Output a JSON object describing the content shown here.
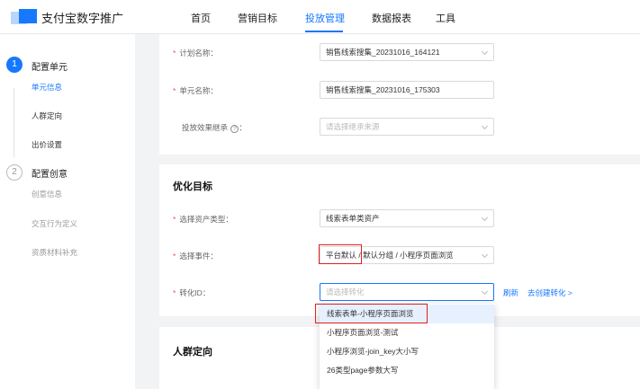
{
  "app": {
    "brand": "支付宝数字推广"
  },
  "nav": {
    "items": [
      "首页",
      "营销目标",
      "投放管理",
      "数据报表",
      "工具"
    ],
    "active_index": 2
  },
  "sidebar": {
    "steps": [
      {
        "num": "1",
        "title": "配置单元",
        "subs": [
          "单元信息",
          "人群定向",
          "出价设置"
        ]
      },
      {
        "num": "2",
        "title": "配置创意",
        "subs": [
          "创意信息",
          "交互行为定义",
          "资质材料补充"
        ]
      }
    ]
  },
  "form": {
    "plan_name": {
      "label": "计划名称：",
      "value": "销售线索搜集_20231016_164121"
    },
    "unit_name": {
      "label": "单元名称：",
      "value": "销售线索搜集_20231016_175303"
    },
    "effect_relay": {
      "label": "投放效果继承",
      "help": "?",
      "colon": "：",
      "placeholder": "请选择继承来源"
    }
  },
  "optimize": {
    "title": "优化目标",
    "asset_type": {
      "label": "选择资产类型：",
      "value": "线索表单类资产"
    },
    "event": {
      "label": "选择事件：",
      "value_highlight": "平台默认",
      "value_rest": " / 默认分组 / 小程序页面浏览"
    },
    "conversion": {
      "label": "转化ID：",
      "placeholder": "请选择转化",
      "refresh": "刷新",
      "create": "去创建转化 >"
    },
    "options": [
      "线索表单-小程序页面浏览",
      "小程序页面浏览-测试",
      "小程序浏览-join_key大小写",
      "26类型page参数大写"
    ]
  },
  "audience": {
    "title": "人群定向"
  },
  "colors": {
    "accent": "#1677ff",
    "highlight": "#e02020",
    "required": "#ff4d4f"
  }
}
